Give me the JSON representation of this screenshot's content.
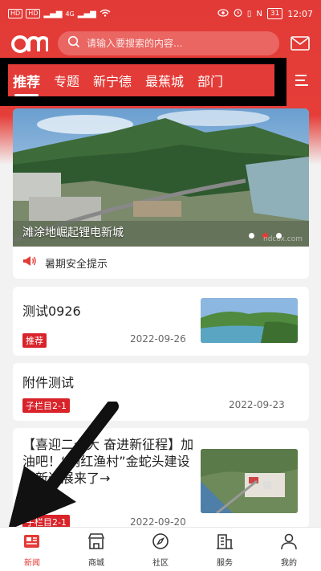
{
  "status_bar": {
    "sim1": "HD",
    "sim2": "HD",
    "signal": "4G",
    "battery": "31",
    "time": "12:07"
  },
  "header": {
    "search_placeholder": "请输入要搜索的内容...",
    "icons": [
      "logo",
      "search-icon",
      "mail-icon",
      "menu-icon"
    ]
  },
  "tabs": [
    "推荐",
    "专题",
    "新宁德",
    "最蕉城",
    "部门"
  ],
  "active_tab": 0,
  "banner": {
    "caption": "滩涂地崛起锂电新城",
    "watermark": "ndcox.com",
    "slide_count": 3,
    "active_slide": 1
  },
  "notice": {
    "text": "暑期安全提示",
    "icon": "speaker-icon"
  },
  "news": [
    {
      "title": "测试0926",
      "tag": "推荐",
      "date": "2022-09-26",
      "has_image": true
    },
    {
      "title": "附件测试",
      "tag": "子栏目2-1",
      "date": "2022-09-23",
      "has_image": false
    },
    {
      "title": "【喜迎二十大 奋进新征程】加油吧！“网红渔村”金蛇头建设最新进展来了→",
      "tag": "子栏目2-1",
      "date": "2022-09-20",
      "has_image": true
    }
  ],
  "bottom_nav": [
    {
      "label": "新闻",
      "icon": "news-icon",
      "active": true
    },
    {
      "label": "商城",
      "icon": "shop-icon",
      "active": false
    },
    {
      "label": "社区",
      "icon": "compass-icon",
      "active": false
    },
    {
      "label": "服务",
      "icon": "building-icon",
      "active": false
    },
    {
      "label": "我的",
      "icon": "user-icon",
      "active": false
    }
  ],
  "colors": {
    "brand": "#e33b37",
    "tag": "#d8232a"
  }
}
